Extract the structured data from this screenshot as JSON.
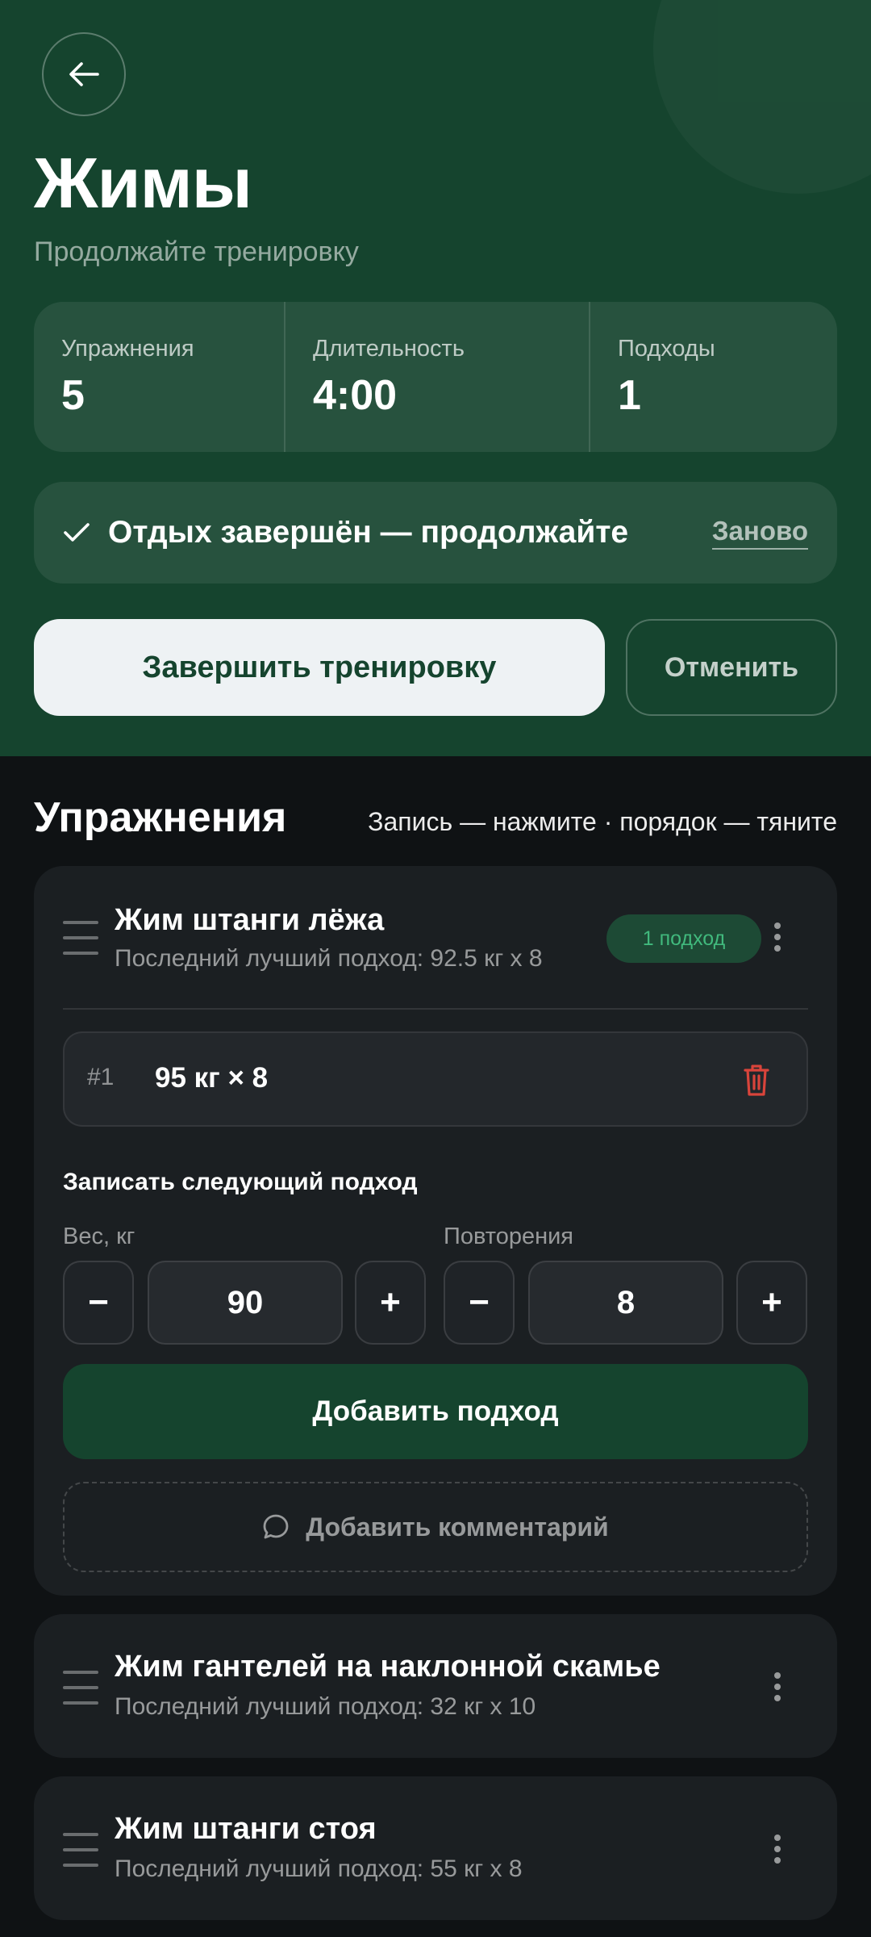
{
  "header": {
    "title": "Жимы",
    "subtitle": "Продолжайте тренировку",
    "back_icon": "arrow-left-icon"
  },
  "stats": [
    {
      "label": "Упражнения",
      "value": "5"
    },
    {
      "label": "Длительность",
      "value": "4:00"
    },
    {
      "label": "Подходы",
      "value": "1"
    }
  ],
  "rest": {
    "text": "Отдых завершён — продолжайте",
    "restart_label": "Заново",
    "icon": "check-icon"
  },
  "actions": {
    "finish_label": "Завершить тренировку",
    "cancel_label": "Отменить"
  },
  "exercises_section": {
    "title": "Упражнения",
    "hint": "Запись — нажмите · порядок — тяните"
  },
  "exercises": [
    {
      "name": "Жим штанги лёжа",
      "best": "Последний лучший подход: 92.5 кг x 8",
      "badge": "1 подход",
      "sets": [
        {
          "num": "#1",
          "value": "95 кг × 8"
        }
      ],
      "next_title": "Записать следующий подход",
      "weight_label": "Вес, кг",
      "weight_value": "90",
      "reps_label": "Повторения",
      "reps_value": "8",
      "minus": "−",
      "plus": "+",
      "add_set_label": "Добавить подход",
      "comment_label": "Добавить комментарий"
    },
    {
      "name": "Жим гантелей на наклонной скамье",
      "best": "Последний лучший подход: 32 кг x 10"
    },
    {
      "name": "Жим штанги стоя",
      "best": "Последний лучший подход: 55 кг x 8"
    }
  ],
  "colors": {
    "hero_bg": "#15442e",
    "page_bg": "#0f1214",
    "card_bg": "#1b1f22",
    "badge_text": "#41b97d",
    "danger": "#d9443b"
  }
}
